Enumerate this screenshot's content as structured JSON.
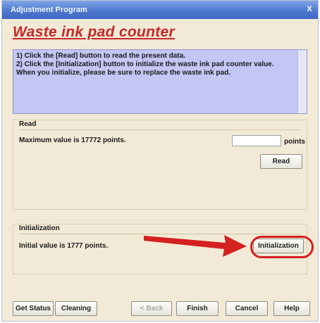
{
  "window": {
    "title": "Adjustment Program",
    "close_glyph": "X"
  },
  "heading": "Waste ink pad counter",
  "instructions": {
    "lines": [
      "1) Click the [Read] button to read the present data.",
      "2) Click the [Initialization] button to initialize the waste ink pad counter value.",
      "When you initialize, please be sure to replace the waste ink pad."
    ]
  },
  "read_section": {
    "title": "Read",
    "max_text": "Maximum value is 17772 points.",
    "value_field": "",
    "unit": "points",
    "button": "Read"
  },
  "init_section": {
    "title": "Initialization",
    "init_text": "Initial value is 1777 points.",
    "button": "Initialization"
  },
  "annotation": {
    "color": "#d42020"
  },
  "footer": {
    "get_status": "Get Status",
    "cleaning": "Cleaning",
    "back": "< Back",
    "finish": "Finish",
    "cancel": "Cancel",
    "help": "Help"
  }
}
